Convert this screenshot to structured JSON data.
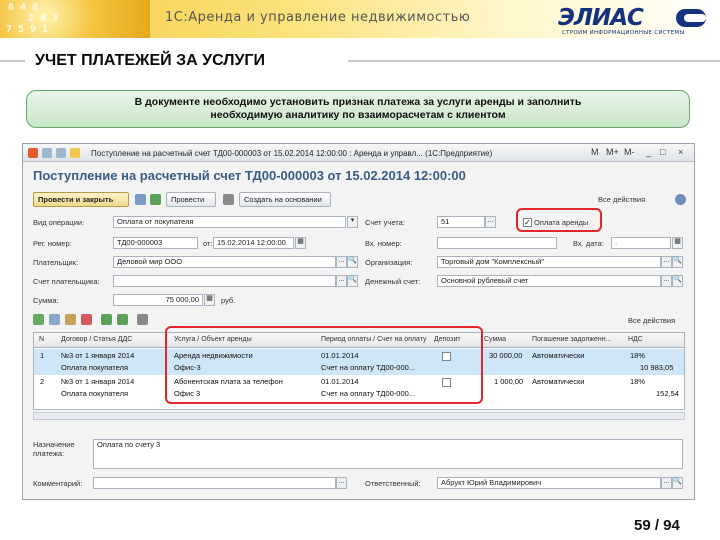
{
  "header": {
    "title": "1С:Аренда и управление недвижимостью",
    "logo_word": "ЭЛИАС",
    "logo_sub": "СТРОИМ ИНФОРМАЦИОННЫЕ СИСТЕМЫ",
    "colors": {
      "band": "#f6c940",
      "brand": "#14327e"
    }
  },
  "section_title": "УЧЕТ ПЛАТЕЖЕЙ ЗА УСЛУГИ",
  "note": {
    "line1": "В документе необходимо установить признак платежа за услуги аренды и заполнить",
    "line2": "необходимую аналитику по взаиморасчетам с клиентом"
  },
  "window": {
    "title": "Поступление на расчетный счет ТД00-000003 от 15.02.2014 12:00:00 : Аренда и управл... (1С:Предприятие)",
    "controls": [
      "M",
      "M+",
      "M-",
      "_",
      "□",
      "×"
    ],
    "doc_title": "Поступление на расчетный счет ТД00-000003 от 15.02.2014 12:00:00",
    "toolbar": {
      "post_close": "Провести и закрыть",
      "post": "Провести",
      "create_based": "Создать на основании",
      "actions": "Все действия"
    },
    "form": {
      "op_type_label": "Вид операции:",
      "op_type_value": "Оплата от покупателя",
      "account_label": "Счет учета:",
      "account_value": "51",
      "rent_payment_label": "Оплата аренды",
      "rent_payment_checked": "✓",
      "reg_no_label": "Рег. номер:",
      "reg_no_value": "ТД00-000003",
      "from_label": "от:",
      "date_value": "15.02.2014 12:00:00",
      "in_no_label": "Вх. номер:",
      "in_date_label": "Вх. дата:",
      "in_date_value": ".",
      "payer_label": "Плательщик:",
      "payer_value": "Деловой мир ООО",
      "org_label": "Организация:",
      "org_value": "Торговый дом \"Комплексный\"",
      "payer_acc_label": "Счет плательщика:",
      "bank_acc_label": "Денежный счет:",
      "bank_acc_value": "Основной рублевый счет",
      "sum_label": "Сумма:",
      "sum_value": "75 000,00",
      "currency": "руб."
    },
    "table_toolbar": {
      "actions": "Все действия"
    },
    "table": {
      "headers": [
        "N",
        "Договор / Статья ДДС",
        "Услуга / Объект аренды",
        "Период оплаты / Счет на оплату",
        "Депозит",
        "Сумма",
        "Погашение задолженн...",
        "НДС"
      ],
      "rows": [
        {
          "n": "1",
          "contract": "№3 от 1 января 2014",
          "dds": "Оплата покупателя",
          "service": "Аренда недвижимости",
          "object": "Офис-3",
          "period": "01.01.2014",
          "invoice": "Счет на оплату ТД00-000...",
          "sum": "30 000,00",
          "repay": "Автоматически",
          "vat_rate": "18%",
          "vat_sum": "10 983,05"
        },
        {
          "n": "2",
          "contract": "№3 от 1 января 2014",
          "dds": "Оплата покупателя",
          "service": "Абонентская плата за телефон",
          "object": "Офис 3",
          "period": "01.01.2014",
          "invoice": "Счет на оплату ТД00-000...",
          "sum": "1 000,00",
          "repay": "Автоматически",
          "vat_rate": "18%",
          "vat_sum": "152,54"
        }
      ]
    },
    "footer": {
      "purpose_label": "Назначение платежа:",
      "purpose_value": "Оплата по счету 3",
      "comment_label": "Комментарий:",
      "responsible_label": "Ответственный:",
      "responsible_value": "Абрукт Юрий Владимирович"
    }
  },
  "page_number": "59 / 94",
  "callout_color": "#e3262b"
}
